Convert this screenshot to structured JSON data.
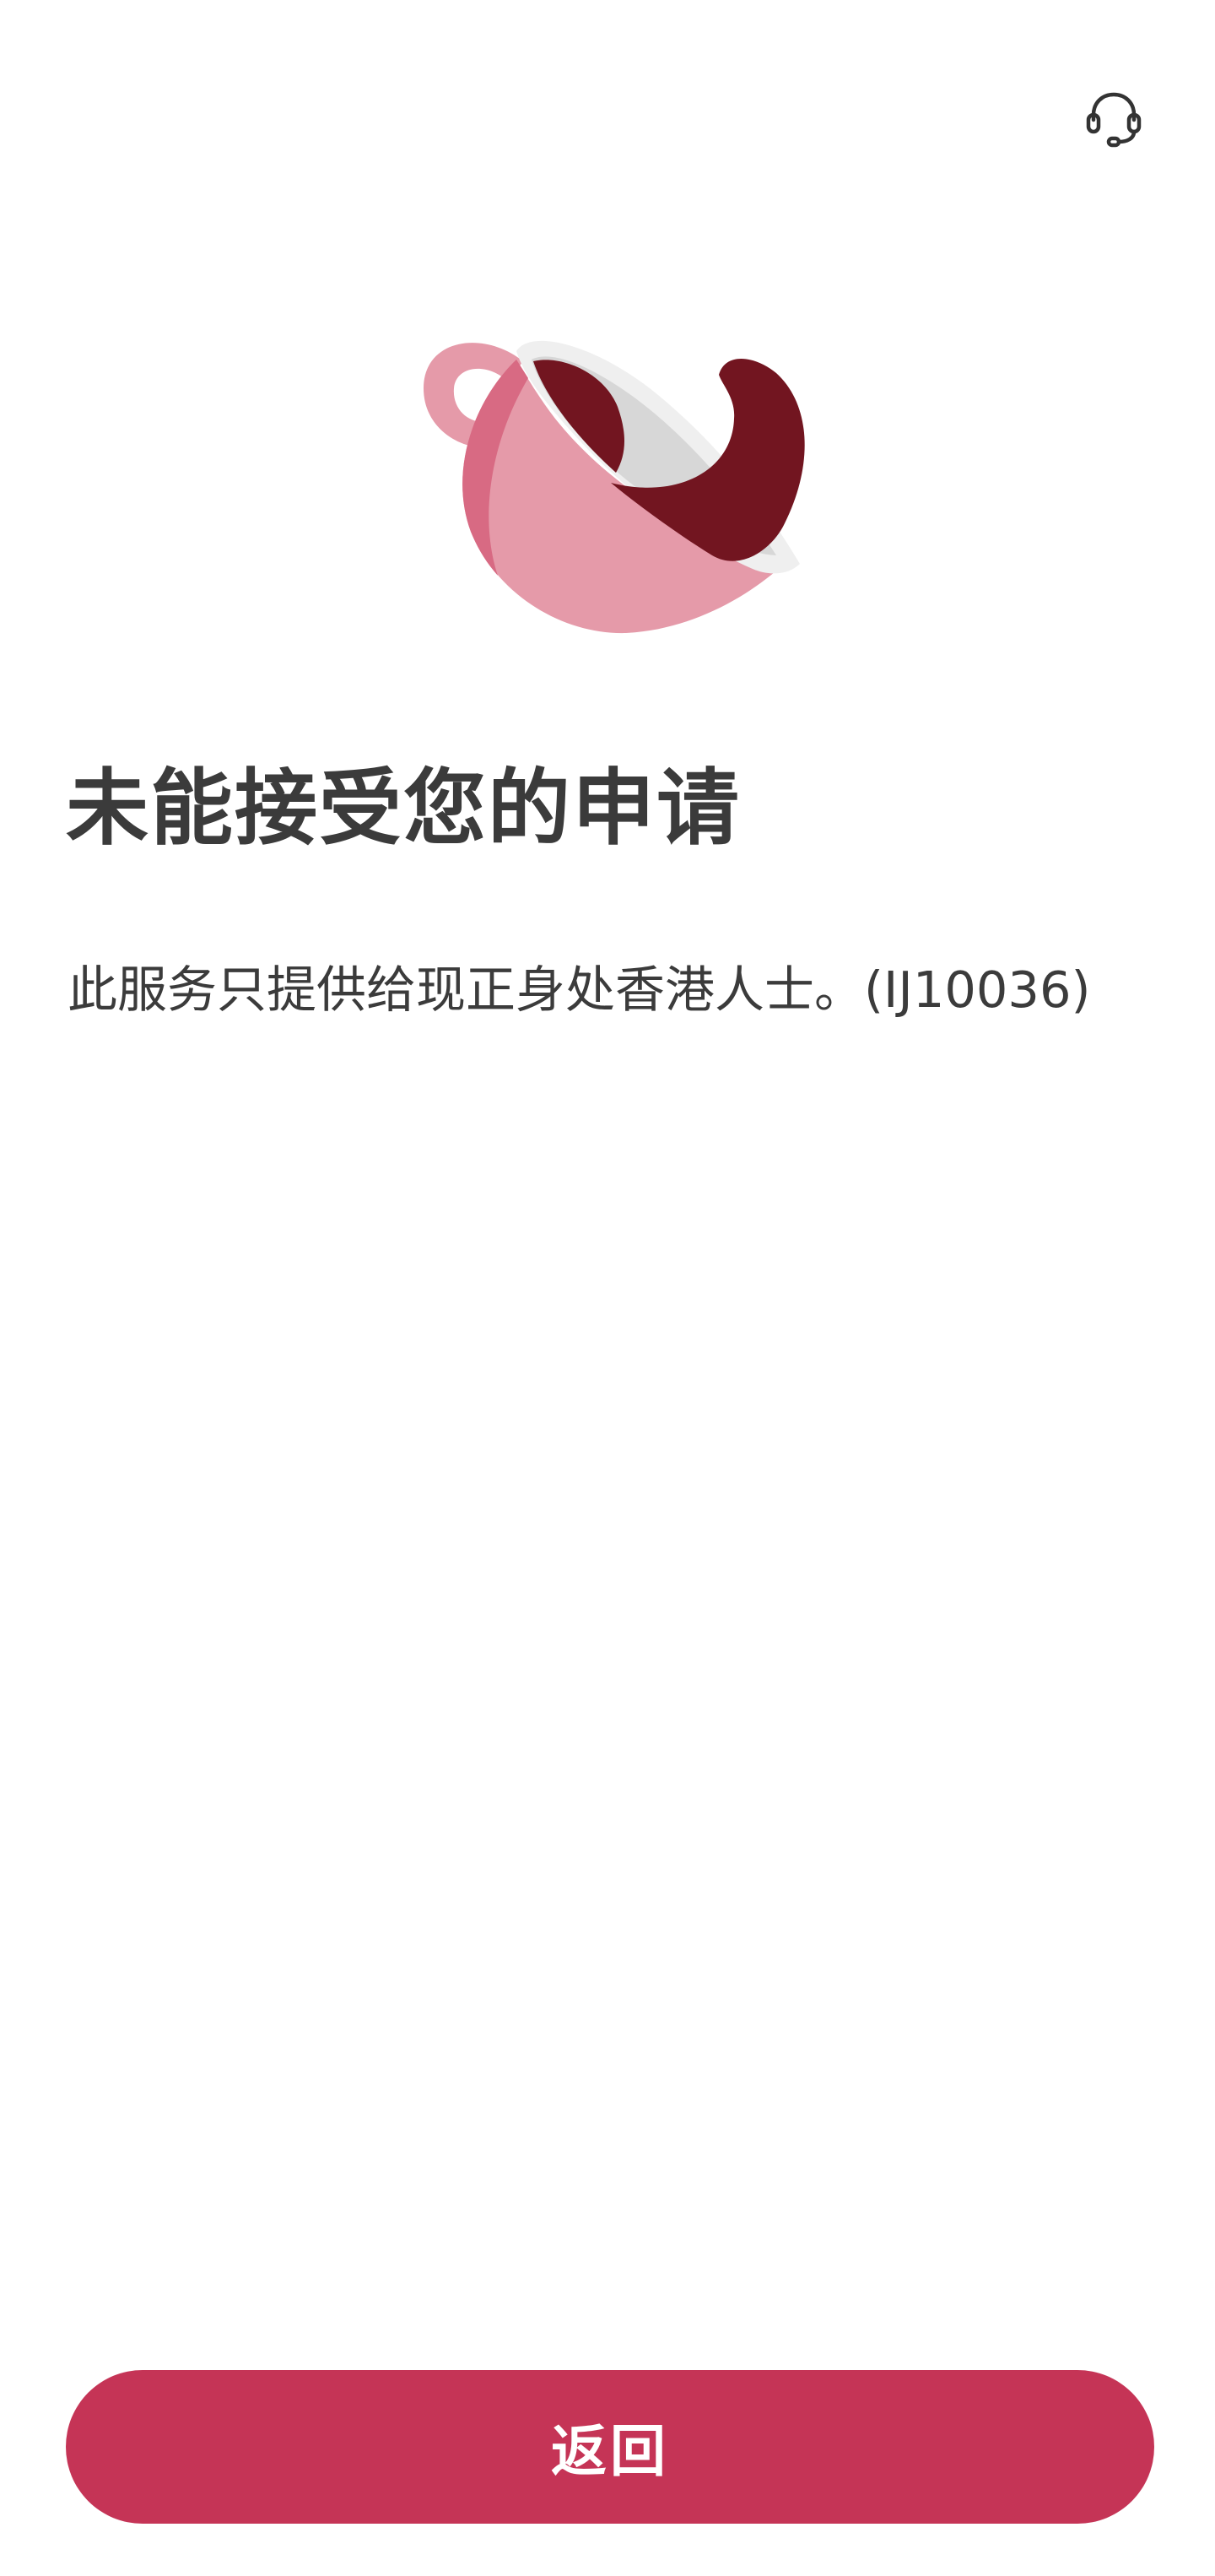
{
  "header": {
    "support_icon": "headset-icon"
  },
  "hero": {
    "illustration_icon": "spilled-teacup-icon",
    "colors": {
      "cup_light": "#e59aa9",
      "cup_dark": "#d86a83",
      "rim": "#efefef",
      "inner": "#d7d7d7",
      "liquid": "#721520"
    }
  },
  "content": {
    "title": "未能接受您的申请",
    "message": "此服务只提供给现正身处香港人士。(IJ10036)"
  },
  "footer": {
    "back_label": "返回"
  },
  "theme": {
    "accent": "#c53456",
    "text": "#3b3b3b",
    "background": "#ffffff"
  }
}
